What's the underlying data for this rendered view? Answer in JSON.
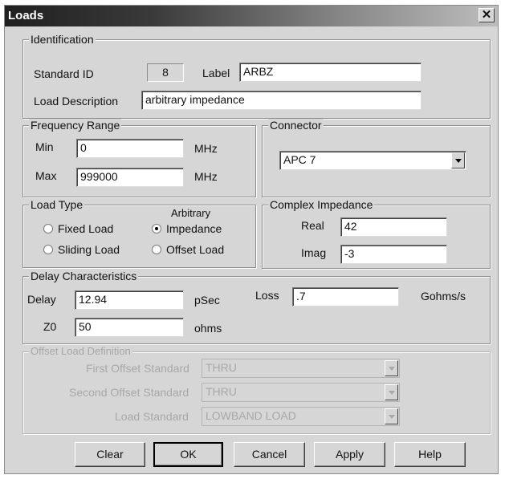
{
  "window": {
    "title": "Loads",
    "close_glyph": "✕"
  },
  "identification": {
    "legend": "Identification",
    "standard_id_label": "Standard ID",
    "standard_id_value": "8",
    "label_label": "Label",
    "label_value": "ARBZ",
    "description_label": "Load Description",
    "description_value": "arbitrary impedance"
  },
  "frequency": {
    "legend": "Frequency Range",
    "min_label": "Min",
    "min_value": "0",
    "min_unit": "MHz",
    "max_label": "Max",
    "max_value": "999000",
    "max_unit": "MHz"
  },
  "connector": {
    "legend": "Connector",
    "selected": "APC 7"
  },
  "load_type": {
    "legend": "Load Type",
    "options": [
      {
        "label": "Fixed Load",
        "selected": false
      },
      {
        "label": "Sliding Load",
        "selected": false
      },
      {
        "label": "Arbitrary",
        "label2": "Impedance",
        "selected": true
      },
      {
        "label": "Offset Load",
        "selected": false
      }
    ]
  },
  "complex_impedance": {
    "legend": "Complex Impedance",
    "real_label": "Real",
    "real_value": "42",
    "imag_label": "Imag",
    "imag_value": "-3"
  },
  "delay": {
    "legend": "Delay Characteristics",
    "delay_label": "Delay",
    "delay_value": "12.94",
    "delay_unit": "pSec",
    "loss_label": "Loss",
    "loss_value": ".7",
    "loss_unit": "Gohms/s",
    "z0_label": "Z0",
    "z0_value": "50",
    "z0_unit": "ohms"
  },
  "offset": {
    "legend": "Offset Load Definition",
    "first_label": "First Offset Standard",
    "first_value": "THRU",
    "second_label": "Second Offset Standard",
    "second_value": "THRU",
    "load_label": "Load Standard",
    "load_value": "LOWBAND LOAD"
  },
  "buttons": {
    "clear": "Clear",
    "ok": "OK",
    "cancel": "Cancel",
    "apply": "Apply",
    "help": "Help"
  }
}
